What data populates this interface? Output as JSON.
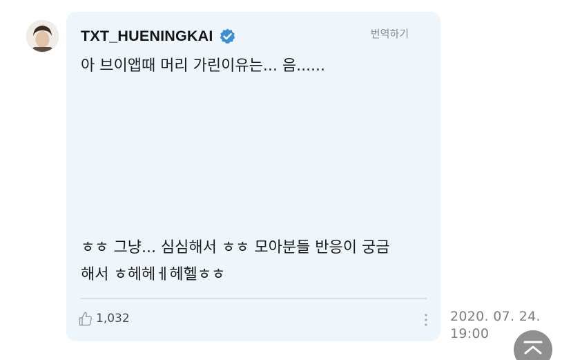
{
  "post": {
    "username": "TXT_HUENINGKAI",
    "translate_label": "번역하기",
    "lines": [
      "아 브이앱때 머리 가린이유는... 음......",
      "ㅎㅎ 그냥... 심심해서 ㅎㅎ 모아분들 반응이 궁금",
      "해서 ㅎ헤헤ㅔ헤헬ㅎㅎ"
    ],
    "like_count": "1,032",
    "timestamp_date": "2020. 07. 24.",
    "timestamp_time": "19:00"
  },
  "colors": {
    "bubble_bg": "#eef6fc",
    "verified": "#3b8fd6",
    "divider": "#cfe2ec",
    "scroll_top_bg": "#8f8f8f"
  },
  "icons": {
    "avatar": "avatar",
    "verified": "verified-badge-icon",
    "like": "thumbs-up-icon",
    "more": "more-vertical-icon",
    "scroll_top": "scroll-to-top-icon"
  }
}
